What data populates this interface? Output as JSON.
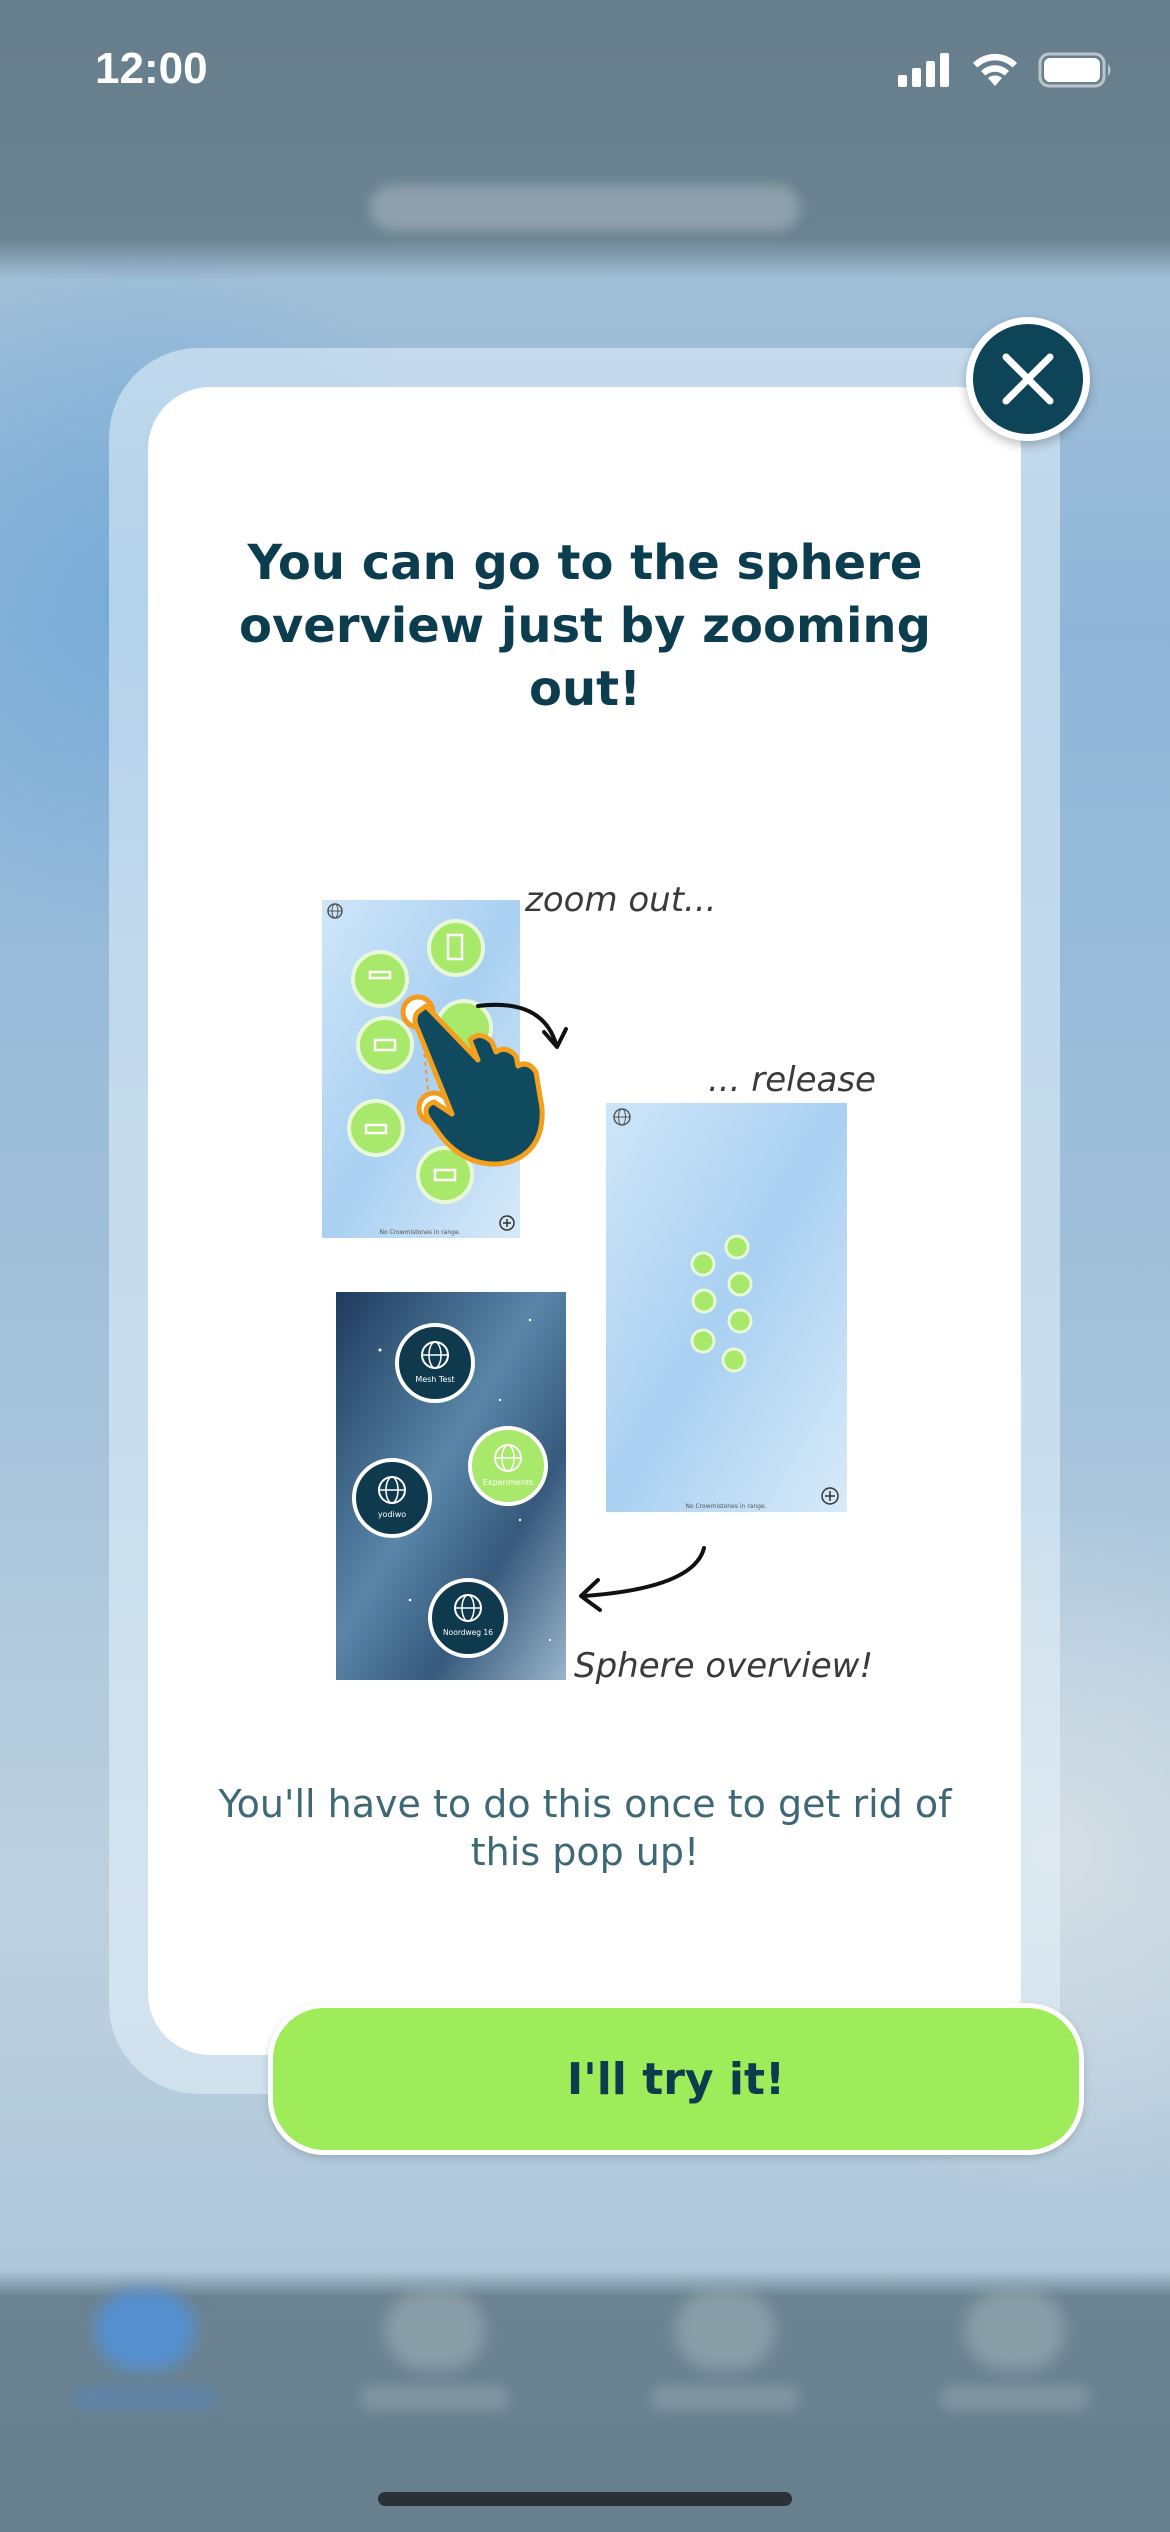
{
  "status_bar": {
    "time": "12:00",
    "icons": [
      "cellular-signal-icon",
      "wifi-icon",
      "battery-icon"
    ]
  },
  "modal": {
    "title": "You can go to the sphere overview just by zooming out!",
    "close_icon": "close-icon",
    "illustration": {
      "caption_zoom": "zoom out...",
      "caption_release": "... release",
      "caption_overview": "Sphere overview!",
      "panel1_footer": "No Crowmistones in range.",
      "panel2_footer": "No Crowmistones in range.",
      "spheres": [
        "Mesh Test",
        "Experiments",
        "yodiwo",
        "Noordweg 16"
      ]
    },
    "note": "You'll have to do this once to get rid of this pop up!",
    "confirm_label": "I'll try it!"
  },
  "colors": {
    "primary_dark": "#0c3d4f",
    "accent_green": "#9fec5a",
    "note_text": "#3f6877"
  }
}
